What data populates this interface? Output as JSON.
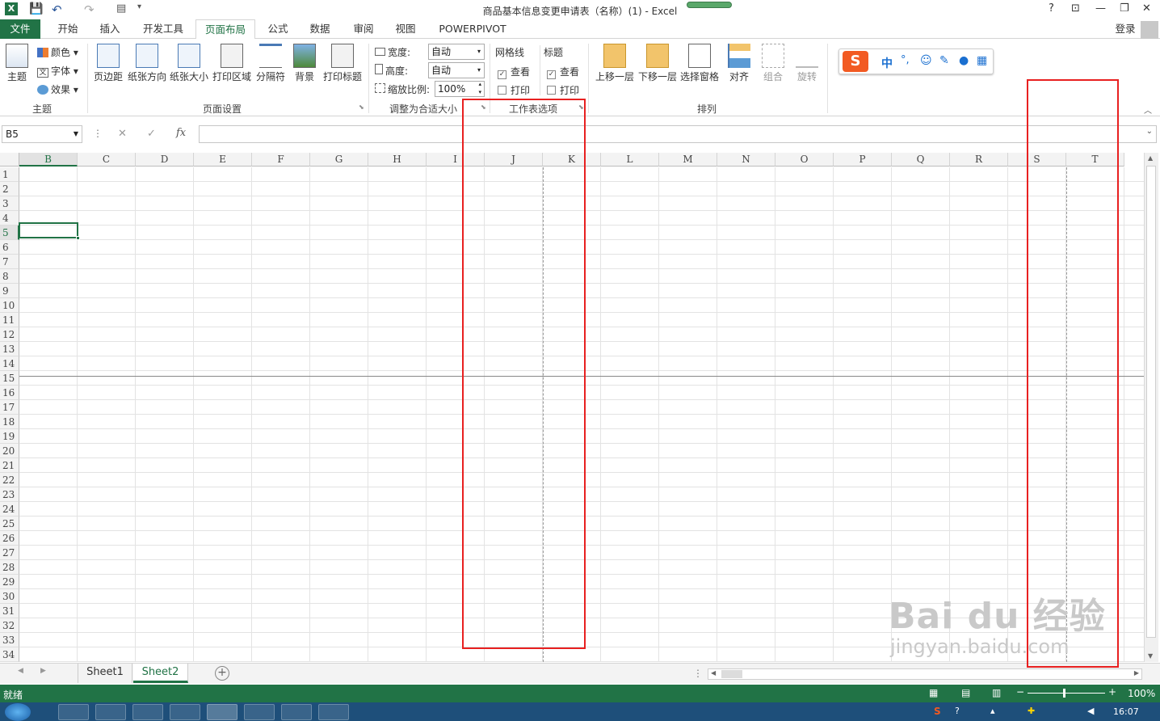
{
  "window": {
    "title": "商品基本信息变更申请表（名称）(1) - Excel",
    "help": "?",
    "minimize": "—",
    "restore": "❐",
    "close": "✕"
  },
  "tabs": [
    "文件",
    "开始",
    "插入",
    "开发工具",
    "页面布局",
    "公式",
    "数据",
    "审阅",
    "视图",
    "POWERPIVOT"
  ],
  "active_tab": "页面布局",
  "login": "登录",
  "ribbon": {
    "theme_group": {
      "label": "主题",
      "theme_button": "主题",
      "colors": "颜色",
      "fonts": "字体",
      "effects": "效果"
    },
    "page_setup_group": {
      "label": "页面设置",
      "buttons": [
        "页边距",
        "纸张方向",
        "纸张大小",
        "打印区域",
        "分隔符",
        "背景",
        "打印标题"
      ]
    },
    "scale_group": {
      "label": "调整为合适大小",
      "width_label": "宽度:",
      "width_value": "自动",
      "height_label": "高度:",
      "height_value": "自动",
      "scale_label": "缩放比例:",
      "scale_value": "100%"
    },
    "sheet_options_group": {
      "label": "工作表选项",
      "gridlines": "网格线",
      "headings": "标题",
      "view": "查看",
      "print": "打印"
    },
    "arrange_group": {
      "label": "排列",
      "buttons": [
        "上移一层",
        "下移一层",
        "选择窗格",
        "对齐",
        "组合",
        "旋转"
      ]
    },
    "ime_toolbar": {
      "chinese": "中",
      "punct": "°,"
    }
  },
  "formula_bar": {
    "name_box": "B5",
    "fx": "fx",
    "cancel": "✕",
    "enter": "✓",
    "formula": ""
  },
  "columns": [
    "B",
    "C",
    "D",
    "E",
    "F",
    "G",
    "H",
    "I",
    "J",
    "K",
    "L",
    "M",
    "N",
    "O",
    "P",
    "Q",
    "R",
    "S",
    "T"
  ],
  "rows": [
    "1",
    "2",
    "3",
    "4",
    "5",
    "6",
    "7",
    "8",
    "9",
    "10",
    "11",
    "12",
    "13",
    "14",
    "15",
    "16",
    "17",
    "18",
    "19",
    "20",
    "21",
    "22",
    "23",
    "24",
    "25",
    "26",
    "27",
    "28",
    "29",
    "30",
    "31",
    "32",
    "33",
    "34"
  ],
  "active_cell": "B5",
  "sheets": [
    "Sheet1",
    "Sheet2"
  ],
  "active_sheet": "Sheet2",
  "status": {
    "ready": "就绪",
    "zoom": "100%"
  },
  "taskbar": {
    "time": "16:07"
  },
  "watermark": {
    "line1": "Bai du 经验",
    "line2": "jingyan.baidu.com"
  },
  "colors": {
    "excel_green": "#217346",
    "highlight_red": "#e82020",
    "taskbar_blue": "#1e4f7a"
  }
}
